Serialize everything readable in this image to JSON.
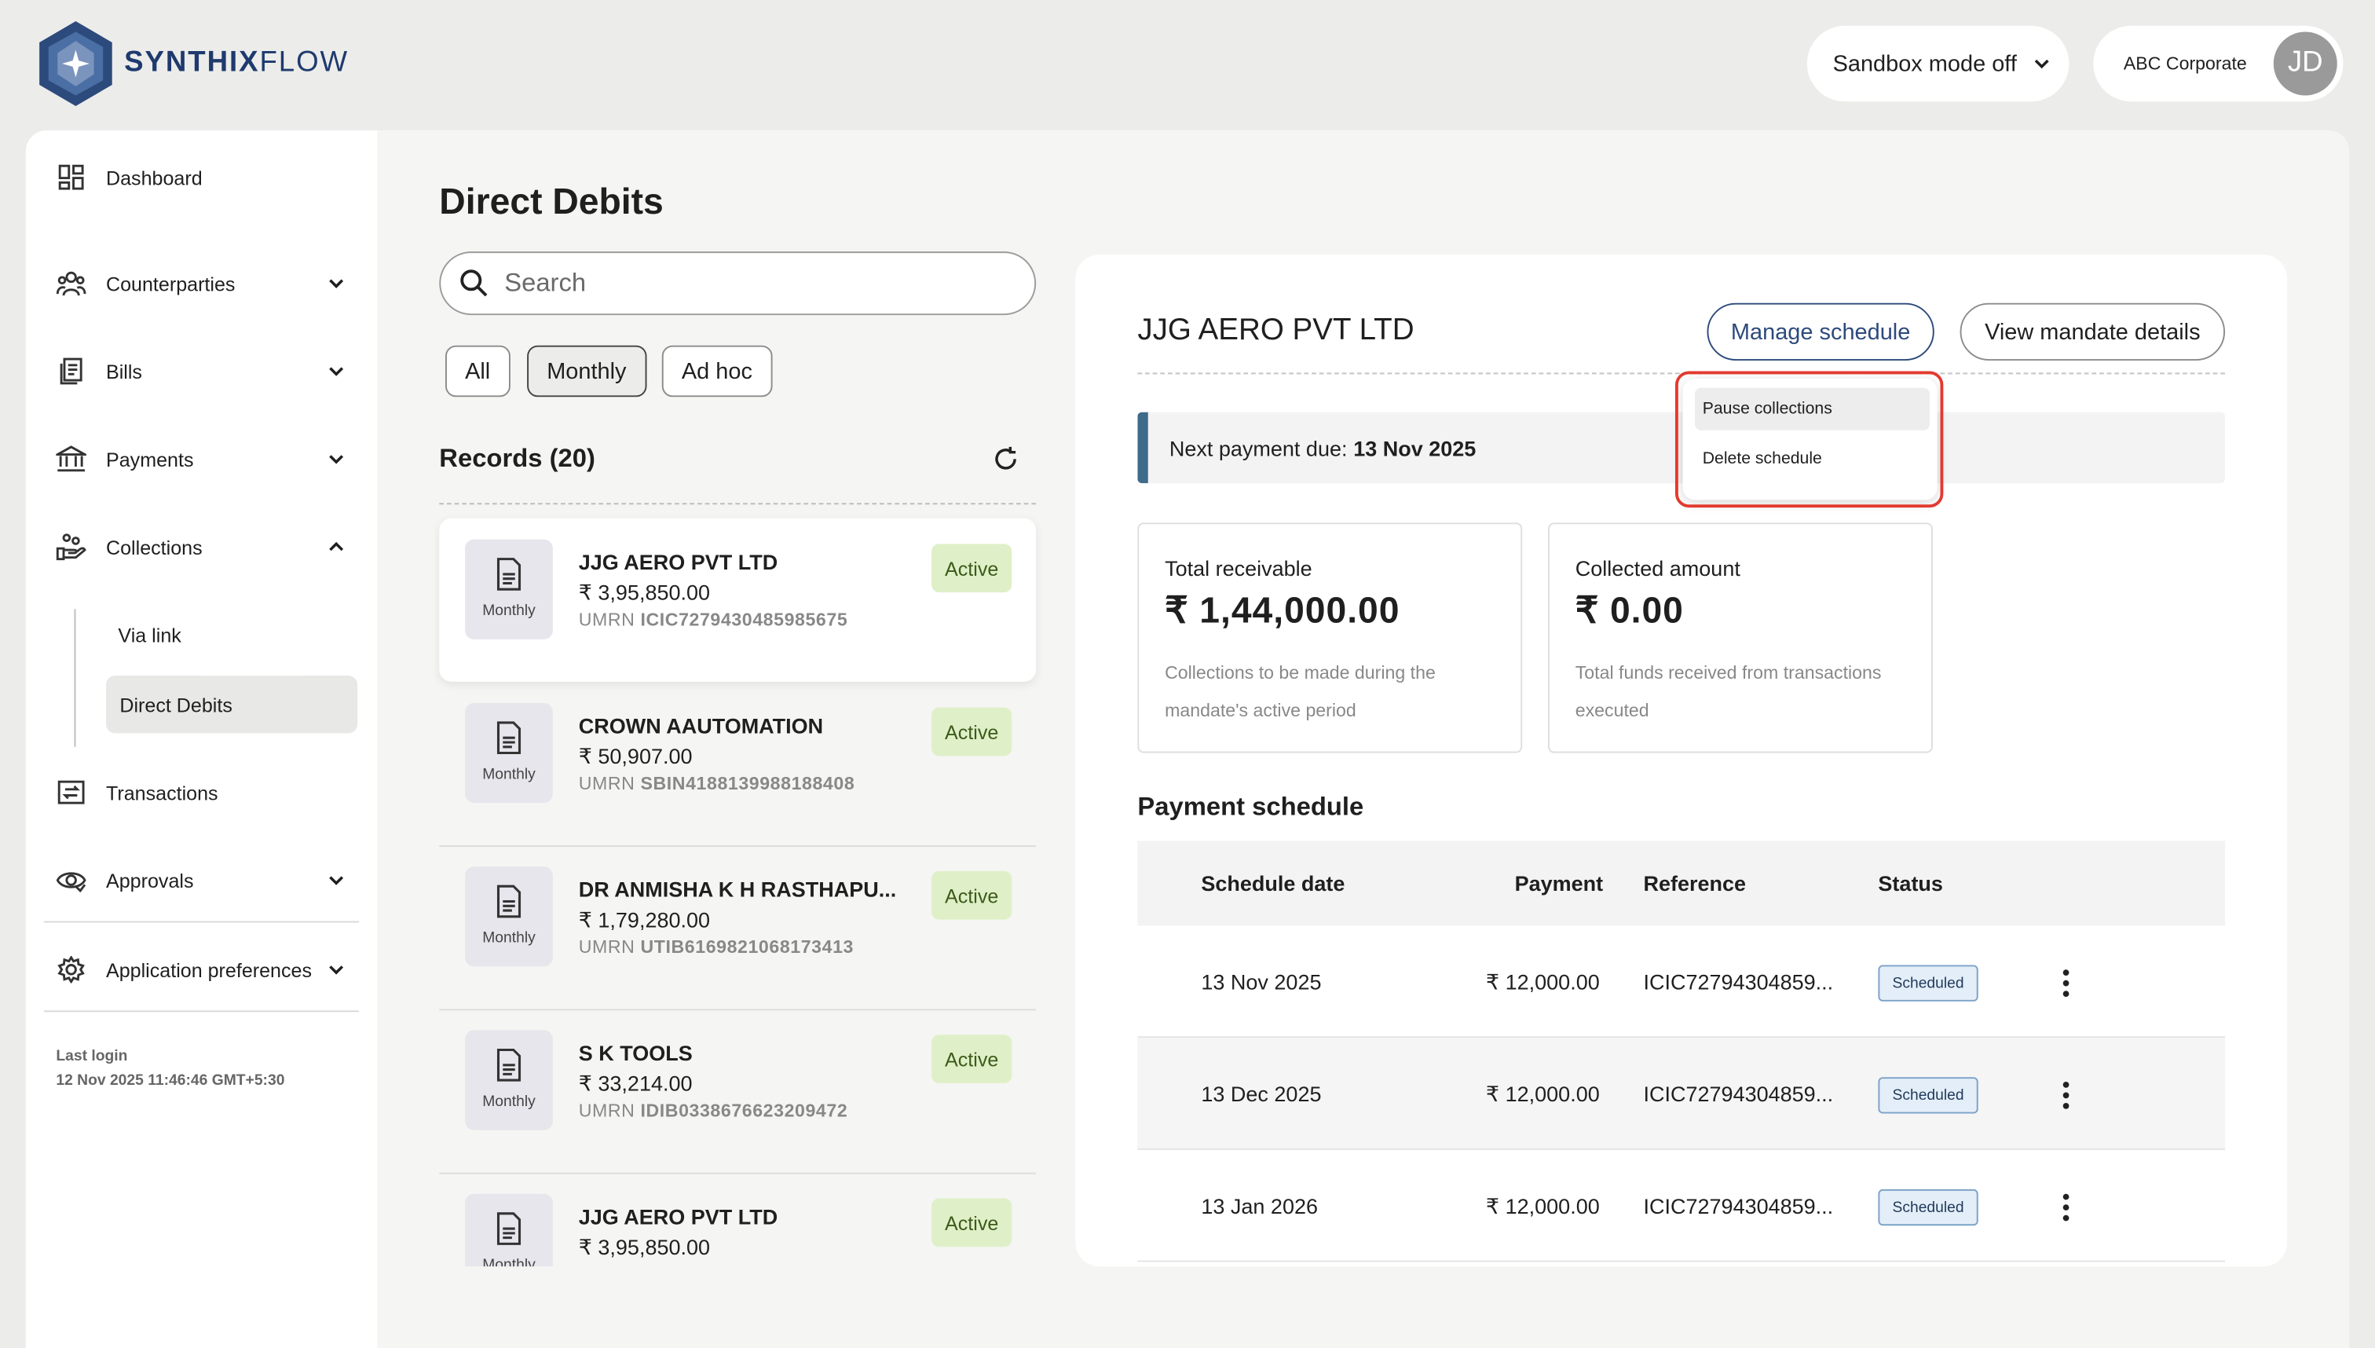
{
  "header": {
    "brand_primary": "SYNTHIX",
    "brand_secondary": "FLOW",
    "sandbox_label": "Sandbox mode off",
    "account_name": "ABC Corporate",
    "avatar_initials": "JD"
  },
  "sidebar": {
    "dashboard": "Dashboard",
    "counterparties": "Counterparties",
    "bills": "Bills",
    "payments": "Payments",
    "collections": "Collections",
    "via_link": "Via link",
    "direct_debits": "Direct Debits",
    "transactions": "Transactions",
    "approvals": "Approvals",
    "app_prefs": "Application preferences",
    "last_login_label": "Last login",
    "last_login_value": "12 Nov 2025 11:46:46 GMT+5:30"
  },
  "page": {
    "title": "Direct Debits",
    "search_placeholder": "Search",
    "filters": [
      "All",
      "Monthly",
      "Ad hoc"
    ],
    "records_title": "Records (20)"
  },
  "records": [
    {
      "name": "JJG AERO PVT LTD",
      "amount": "₹ 3,95,850.00",
      "umrn_label": "UMRN",
      "umrn": "ICIC7279430485985675",
      "freq": "Monthly",
      "status": "Active"
    },
    {
      "name": "CROWN AAUTOMATION",
      "amount": "₹ 50,907.00",
      "umrn_label": "UMRN",
      "umrn": "SBIN4188139988188408",
      "freq": "Monthly",
      "status": "Active"
    },
    {
      "name": "DR ANMISHA K H RASTHAPU...",
      "amount": "₹ 1,79,280.00",
      "umrn_label": "UMRN",
      "umrn": "UTIB6169821068173413",
      "freq": "Monthly",
      "status": "Active"
    },
    {
      "name": "S K TOOLS",
      "amount": "₹ 33,214.00",
      "umrn_label": "UMRN",
      "umrn": "IDIB0338676623209472",
      "freq": "Monthly",
      "status": "Active"
    },
    {
      "name": "JJG AERO PVT LTD",
      "amount": "₹ 3,95,850.00",
      "umrn_label": "",
      "umrn": "",
      "freq": "Monthly",
      "status": "Active"
    }
  ],
  "detail": {
    "title": "JJG AERO PVT LTD",
    "manage_btn": "Manage schedule",
    "view_btn": "View mandate details",
    "next_due_label": "Next payment due:",
    "next_due_value": "13 Nov 2025",
    "total_receivable_label": "Total receivable",
    "total_receivable_value": "₹ 1,44,000.00",
    "total_receivable_desc": "Collections to be made during the mandate's active period",
    "collected_label": "Collected amount",
    "collected_value": "₹ 0.00",
    "collected_desc": "Total funds received from transactions executed",
    "schedule_title": "Payment schedule",
    "columns": {
      "date": "Schedule date",
      "payment": "Payment",
      "reference": "Reference",
      "status": "Status"
    },
    "rows": [
      {
        "date": "13 Nov 2025",
        "payment": "₹ 12,000.00",
        "reference": "ICIC72794304859...",
        "status": "Scheduled"
      },
      {
        "date": "13 Dec 2025",
        "payment": "₹ 12,000.00",
        "reference": "ICIC72794304859...",
        "status": "Scheduled"
      },
      {
        "date": "13 Jan 2026",
        "payment": "₹ 12,000.00",
        "reference": "ICIC72794304859...",
        "status": "Scheduled"
      }
    ]
  },
  "menu": {
    "pause": "Pause collections",
    "delete": "Delete schedule"
  },
  "colors": {
    "brand": "#1e3a6e",
    "active_bg": "#dff0c8",
    "accent_bar": "#3f6b8a",
    "highlight_box": "#e33a2f"
  }
}
